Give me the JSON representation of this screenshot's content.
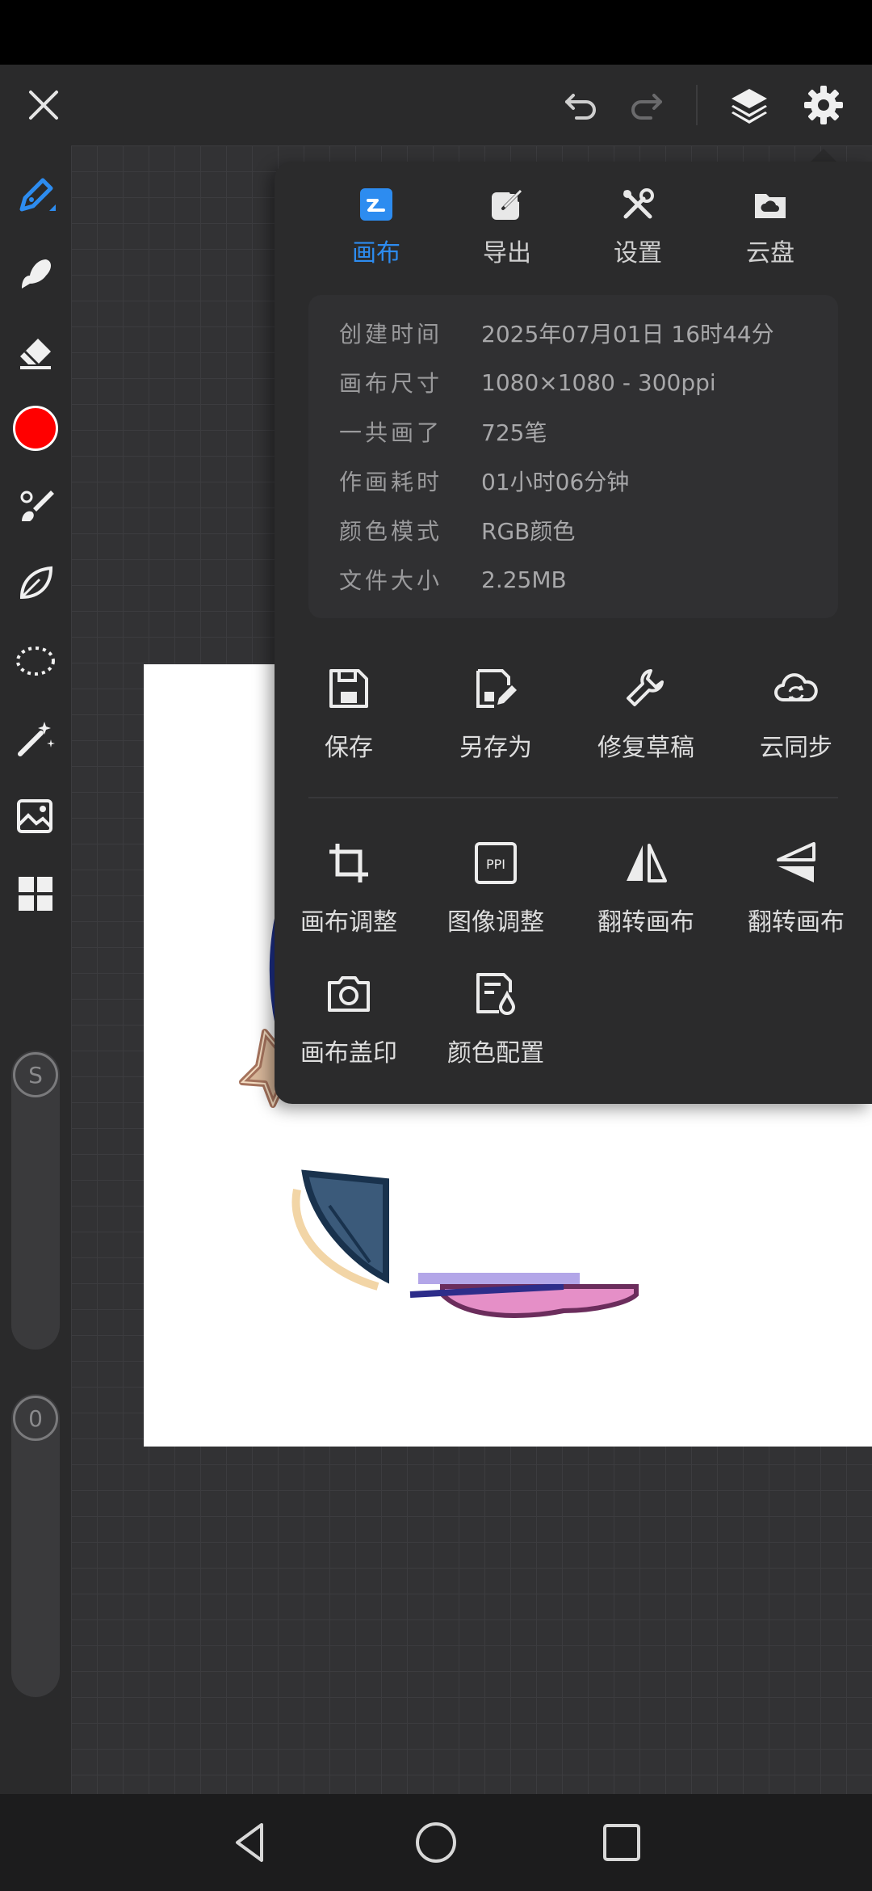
{
  "panel": {
    "tabs": [
      {
        "label": "画布"
      },
      {
        "label": "导出"
      },
      {
        "label": "设置"
      },
      {
        "label": "云盘"
      }
    ],
    "info": [
      {
        "key": "创建时间",
        "value": "2025年07月01日 16时44分"
      },
      {
        "key": "画布尺寸",
        "value": "1080×1080 - 300ppi"
      },
      {
        "key": "一共画了",
        "value": "725笔"
      },
      {
        "key": "作画耗时",
        "value": "01小时06分钟"
      },
      {
        "key": "颜色模式",
        "value": "RGB颜色"
      },
      {
        "key": "文件大小",
        "value": "2.25MB"
      }
    ],
    "actions_row1": [
      {
        "label": "保存"
      },
      {
        "label": "另存为"
      },
      {
        "label": "修复草稿"
      },
      {
        "label": "云同步"
      }
    ],
    "actions_row2": [
      {
        "label": "画布调整"
      },
      {
        "label": "图像调整",
        "icon_text": "PPI"
      },
      {
        "label": "翻转画布"
      },
      {
        "label": "翻转画布"
      }
    ],
    "actions_row3": [
      {
        "label": "画布盖印"
      },
      {
        "label": "颜色配置"
      }
    ]
  },
  "toolbar": {
    "current_color": "#ff0000",
    "size_slider_label": "S",
    "opacity_slider_label": "0"
  },
  "colors": {
    "accent": "#2d8cf0",
    "panel_bg": "#2b2b2c",
    "canvas_bg": "#ffffff"
  }
}
